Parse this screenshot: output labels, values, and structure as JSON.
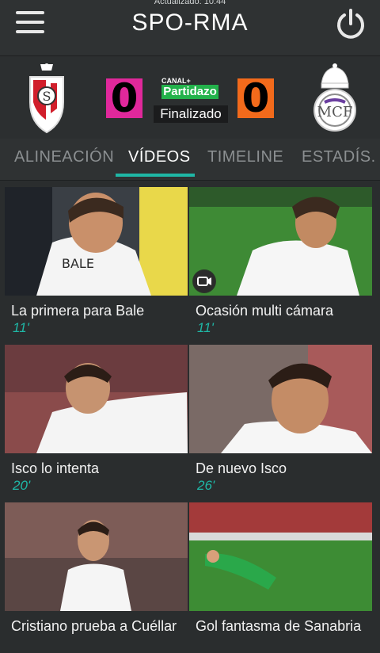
{
  "header": {
    "updated": "Actualizado: 10:44",
    "title": "SPO-RMA"
  },
  "match": {
    "home_score": "0",
    "away_score": "0",
    "broadcaster_top": "CANAL+",
    "broadcaster_name": "Partidazo",
    "status": "Finalizado",
    "colors": {
      "home_score_bg": "#e0289b",
      "away_score_bg": "#f26a1b",
      "accent": "#1fb7a6"
    }
  },
  "tabs": [
    {
      "label": "ALINEACIÓN"
    },
    {
      "label": "VÍDEOS"
    },
    {
      "label": "TIMELINE"
    },
    {
      "label": "ESTADÍS."
    }
  ],
  "videos": [
    {
      "title": "La primera para Bale",
      "minute": "11'"
    },
    {
      "title": "Ocasión multi cámara",
      "minute": "11'"
    },
    {
      "title": "Isco lo intenta",
      "minute": "20'"
    },
    {
      "title": "De nuevo Isco",
      "minute": "26'"
    },
    {
      "title": "Cristiano prueba a Cuéllar",
      "minute": ""
    },
    {
      "title": "Gol fantasma de Sanabria",
      "minute": ""
    }
  ],
  "icons": [
    "menu-icon",
    "power-icon",
    "video-camera-icon",
    "sporting-crest-icon",
    "real-madrid-crest-icon"
  ]
}
